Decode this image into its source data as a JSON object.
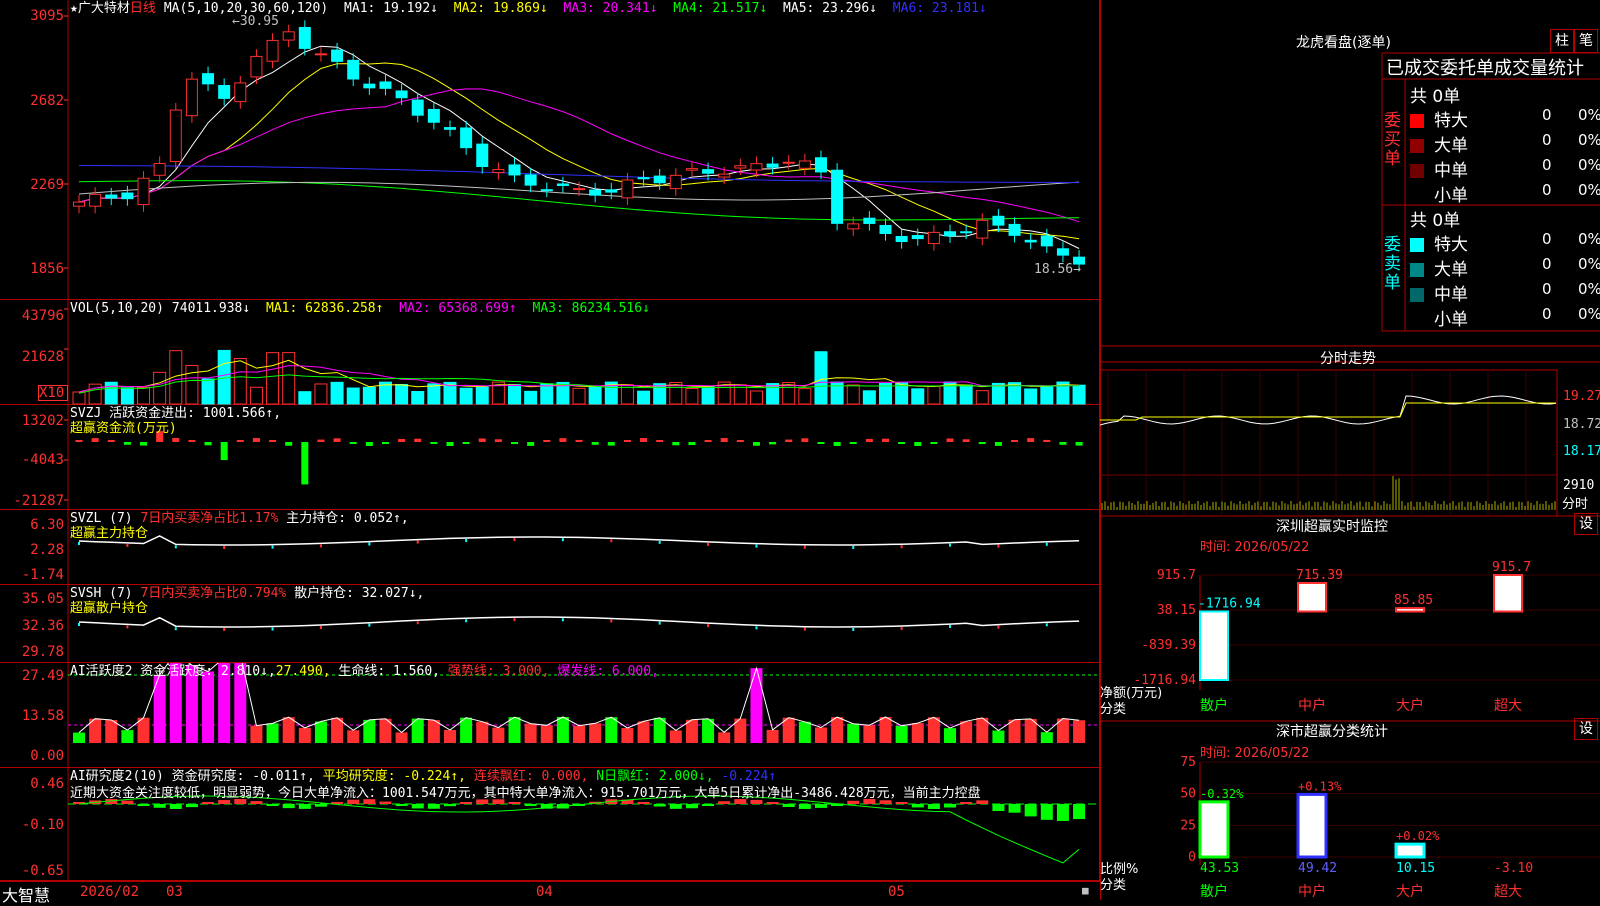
{
  "stock": {
    "name": "★广大特材",
    "period": "日线"
  },
  "main_chart": {
    "ma_header": "MA(5,10,20,30,60,120)",
    "ma": [
      {
        "label": "MA1: 19.192↓",
        "color": "#ffffff"
      },
      {
        "label": "MA2: 19.869↓",
        "color": "#ffff00"
      },
      {
        "label": "MA3: 20.341↓",
        "color": "#ff00ff"
      },
      {
        "label": "MA4: 21.517↓",
        "color": "#00ff00"
      },
      {
        "label": "MA5: 23.296↓",
        "color": "#ffffff"
      },
      {
        "label": "MA6: 23.181↓",
        "color": "#3030ff"
      }
    ],
    "y_labels": [
      "3095",
      "2682",
      "2269",
      "1856"
    ],
    "high_mark": "30.95",
    "low_mark": "18.56"
  },
  "vol_chart": {
    "header_name": "VOL(5,10,20)",
    "header_value": "74011.938↓",
    "ma": [
      {
        "label": "MA1: 62836.258↑",
        "color": "#ffff00"
      },
      {
        "label": "MA2: 65368.699↑",
        "color": "#ff00ff"
      },
      {
        "label": "MA3: 86234.516↓",
        "color": "#00ff00"
      }
    ],
    "y_labels": [
      "43796",
      "21628"
    ],
    "unit": "X10"
  },
  "svzj": {
    "header": "SVZJ  活跃资金进出: 1001.566↑,",
    "sub": "超赢资金流(万元)",
    "y_labels": [
      "13202",
      "-4043",
      "-21287"
    ]
  },
  "svzl": {
    "header_a": "SVZL (7)",
    "header_b": "7日内买卖净占比1.17%",
    "header_c": "主力持仓: 0.052↑,",
    "sub": "超赢主力持仓",
    "y_labels": [
      "6.30",
      "2.28",
      "-1.74"
    ]
  },
  "svsh": {
    "header_a": "SVSH (7)",
    "header_b": "7日内买卖净占比0.794%",
    "header_c": "散户持仓: 32.027↓,",
    "sub": "超赢散户持仓",
    "y_labels": [
      "35.05",
      "32.36",
      "29.78"
    ]
  },
  "ai_active": {
    "h1": "AI活跃度2 资金活跃度: 2.810↓,",
    "h2": "27.490,",
    "h3": "生命线: 1.560,",
    "h4": "强势线: 3.000,",
    "h5": "爆发线: 6.000,",
    "y_labels": [
      "27.49",
      "13.58",
      "0.00"
    ]
  },
  "ai_research": {
    "h1": "AI研究度2(10) 资金研究度: -0.011↑,",
    "h2": "平均研究度: -0.224↑,",
    "h3": "连续飘红: 0.000,",
    "h4": "N日飘红: 2.000↓,",
    "h5": "-0.224↑",
    "comment": "近期大资金关注度较低，明显弱势，今日大单净流入：1001.547万元，其中特大单净流入：915.701万元，大单5日累计净出-3486.428万元，当前主力控盘",
    "y_labels": [
      "0.46",
      "-0.10",
      "-0.65"
    ]
  },
  "bottom_bar": {
    "brand": "大智慧",
    "dates": [
      "2026/02",
      "03",
      "04",
      "05"
    ]
  },
  "dragon": {
    "title": "龙虎看盘(逐单)",
    "btn1": "柱",
    "btn2": "笔",
    "subtitle": "已成交委托单成交量统计",
    "buy_label": "委买单",
    "sell_label": "委卖单",
    "buy_total": "共 0单",
    "sell_total": "共 0单",
    "buy_rows": [
      {
        "name": "特大",
        "count": "0",
        "pct": "0%",
        "color": "#ff0000"
      },
      {
        "name": "大单",
        "count": "0",
        "pct": "0%",
        "color": "#900000"
      },
      {
        "name": "中单",
        "count": "0",
        "pct": "0%",
        "color": "#700000"
      },
      {
        "name": "小单",
        "count": "0",
        "pct": "0%",
        "color": ""
      }
    ],
    "sell_rows": [
      {
        "name": "特大",
        "count": "0",
        "pct": "0%",
        "color": "#00ffff"
      },
      {
        "name": "大单",
        "count": "0",
        "pct": "0%",
        "color": "#008888"
      },
      {
        "name": "中单",
        "count": "0",
        "pct": "0%",
        "color": "#006868"
      },
      {
        "name": "小单",
        "count": "0",
        "pct": "0%",
        "color": ""
      }
    ]
  },
  "timeshare": {
    "title": "分时走势",
    "y_labels": [
      "19.27",
      "18.72",
      "18.17"
    ],
    "vol_label": "2910",
    "vol_unit": "分时"
  },
  "monitor": {
    "title": "深圳超赢实时监控",
    "btn": "设",
    "time": "时间: 2026/05/22",
    "y_labels": [
      "915.7",
      "38.15",
      "-839.39",
      "-1716.94"
    ],
    "axis1": "净额(万元)",
    "axis2": "分类",
    "categories": [
      "散户",
      "中户",
      "大户",
      "超大"
    ],
    "values": [
      -1716.94,
      715.39,
      85.85,
      915.7
    ],
    "value_labels": [
      "-1716.94",
      "715.39",
      "85.85",
      "915.7"
    ]
  },
  "classify": {
    "title": "深市超赢分类统计",
    "btn": "设",
    "time": "时间: 2026/05/22",
    "y_labels": [
      "75",
      "50",
      "25",
      "0"
    ],
    "axis1": "比例%",
    "axis2": "分类",
    "categories": [
      "散户",
      "中户",
      "大户",
      "超大"
    ],
    "ratios": [
      43.53,
      49.42,
      10.15,
      -3.1
    ],
    "ratio_labels": [
      "43.53",
      "49.42",
      "10.15",
      "-3.10"
    ],
    "changes": [
      "-0.32%",
      "+0.13%",
      "+0.02%",
      ""
    ]
  }
}
